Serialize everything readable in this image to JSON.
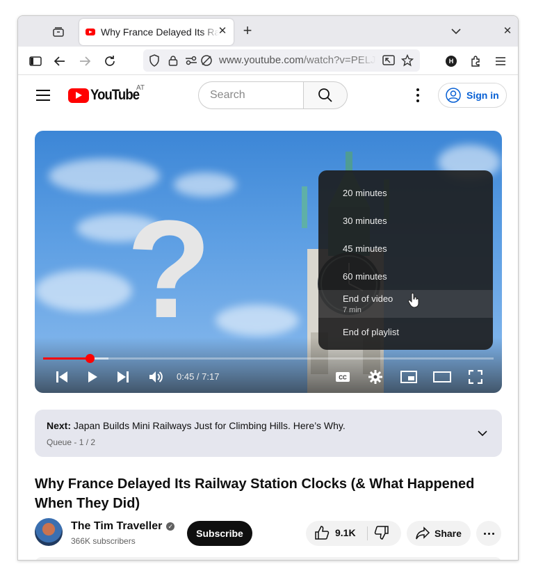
{
  "browser": {
    "tab_title": "Why France Delayed Its Railway Station Clocks (& What Happened When They Did)",
    "url_host": "www.youtube.com",
    "url_path": "/watch?v=PELJ",
    "profile_initial": "H"
  },
  "youtube": {
    "logo_text": "YouTube",
    "country_code": "AT",
    "search_placeholder": "Search",
    "sign_in_label": "Sign in"
  },
  "player": {
    "time_display": "0:45 / 7:17",
    "progress_fraction": 0.103,
    "buffer_fraction": 0.145,
    "sleep_timer_menu": [
      {
        "label": "20 minutes",
        "sub": ""
      },
      {
        "label": "30 minutes",
        "sub": ""
      },
      {
        "label": "45 minutes",
        "sub": ""
      },
      {
        "label": "60 minutes",
        "sub": ""
      },
      {
        "label": "End of video",
        "sub": "7 min"
      },
      {
        "label": "End of playlist",
        "sub": ""
      }
    ]
  },
  "queue": {
    "next_label": "Next:",
    "next_title": " Japan Builds Mini Railways Just for Climbing Hills. Here’s Why.",
    "position": "Queue - 1 / 2"
  },
  "video": {
    "title": "Why France Delayed Its Railway Station Clocks (& What Happened When They Did)",
    "channel_name": "The Tim Traveller",
    "subscribers": "366K subscribers",
    "subscribe_label": "Subscribe",
    "likes": "9.1K",
    "share_label": "Share"
  },
  "colors": {
    "brand_red": "#ff0000",
    "link_blue": "#065fd4"
  }
}
